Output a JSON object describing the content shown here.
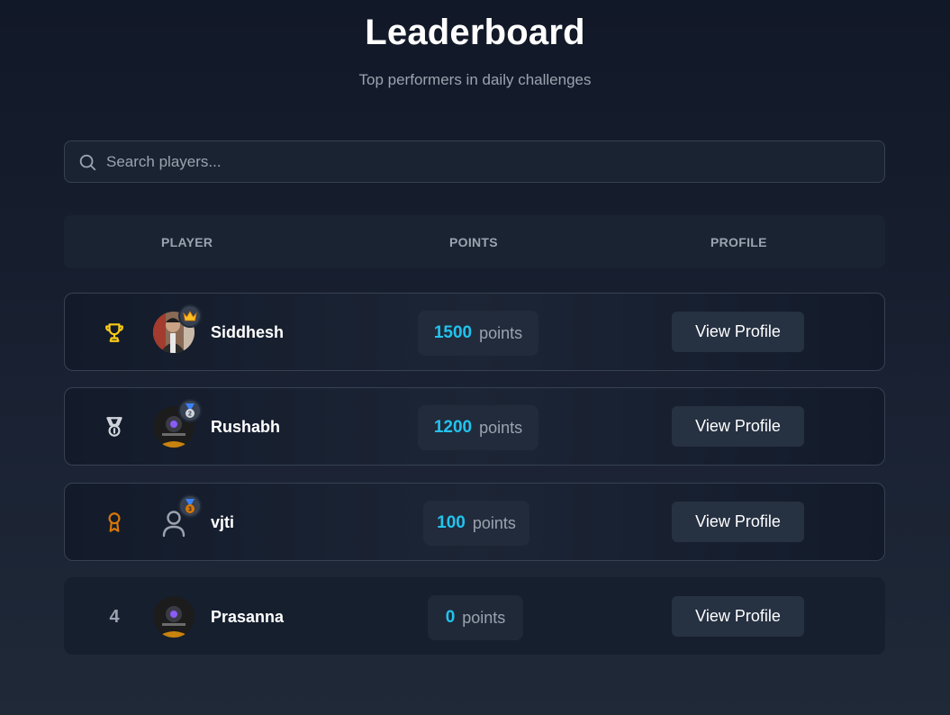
{
  "header": {
    "title": "Leaderboard",
    "subtitle": "Top performers in daily challenges"
  },
  "search": {
    "placeholder": "Search players...",
    "value": ""
  },
  "columns": {
    "player": "PLAYER",
    "points": "POINTS",
    "profile": "PROFILE"
  },
  "rows": [
    {
      "rank": "1",
      "rank_icon": "trophy-icon",
      "name": "Siddhesh",
      "points": "1500",
      "points_label": "points",
      "button": "View Profile",
      "badge": "crown-icon"
    },
    {
      "rank": "2",
      "rank_icon": "medal-icon",
      "name": "Rushabh",
      "points": "1200",
      "points_label": "points",
      "button": "View Profile",
      "badge": "2"
    },
    {
      "rank": "3",
      "rank_icon": "award-icon",
      "name": "vjti",
      "points": "100",
      "points_label": "points",
      "button": "View Profile",
      "badge": "3"
    },
    {
      "rank": "4",
      "rank_icon": "",
      "name": "Prasanna",
      "points": "0",
      "points_label": "points",
      "button": "View Profile",
      "badge": ""
    }
  ],
  "colors": {
    "accent": "#22c3ee",
    "gold": "#facc15",
    "silver": "#d1d5db",
    "bronze": "#d97706",
    "background": "#111827"
  }
}
